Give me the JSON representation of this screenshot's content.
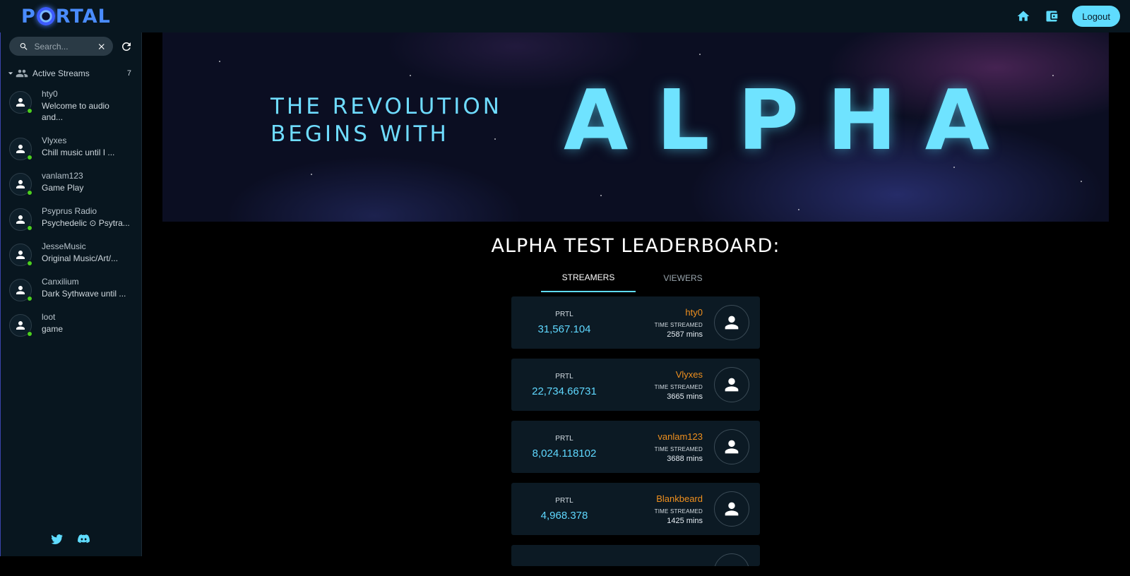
{
  "header": {
    "logo_prefix": "P",
    "logo_suffix": "RTAL",
    "logout_label": "Logout",
    "icons": [
      "home-icon",
      "wallet-icon"
    ]
  },
  "sidebar": {
    "search_placeholder": "Search...",
    "section_label": "Active Streams",
    "section_count": "7",
    "streams": [
      {
        "name": "hty0",
        "desc": "Welcome to audio and..."
      },
      {
        "name": "Vlyxes",
        "desc": "Chill music until I ..."
      },
      {
        "name": "vanlam123",
        "desc": "Game Play"
      },
      {
        "name": "Psyprus Radio",
        "desc": "Psychedelic ⊙ Psytra..."
      },
      {
        "name": "JesseMusic",
        "desc": "Original Music/Art/..."
      },
      {
        "name": "Canxilium",
        "desc": "Dark Sythwave until ..."
      },
      {
        "name": "loot",
        "desc": "game"
      }
    ],
    "social_icons": [
      "twitter-icon",
      "discord-icon"
    ]
  },
  "banner": {
    "line1": "THE REVOLUTION",
    "line2": "BEGINS WITH",
    "headline": "ALPHA"
  },
  "leaderboard": {
    "title": "ALPHA TEST LEADERBOARD:",
    "tabs": [
      {
        "label": "STREAMERS",
        "active": true
      },
      {
        "label": "VIEWERS",
        "active": false
      }
    ],
    "prtl_label": "PRTL",
    "time_label": "TIME STREAMED",
    "entries": [
      {
        "username": "hty0",
        "prtl": "31,567.104",
        "time": "2587 mins"
      },
      {
        "username": "Vlyxes",
        "prtl": "22,734.66731",
        "time": "3665 mins"
      },
      {
        "username": "vanlam123",
        "prtl": "8,024.118102",
        "time": "3688 mins"
      },
      {
        "username": "Blankbeard",
        "prtl": "4,968.378",
        "time": "1425 mins"
      }
    ]
  },
  "colors": {
    "accent": "#5fdcff",
    "username": "#f0901e",
    "online": "#4ccf1f",
    "panel": "#08161f",
    "card": "#0c1a24"
  }
}
